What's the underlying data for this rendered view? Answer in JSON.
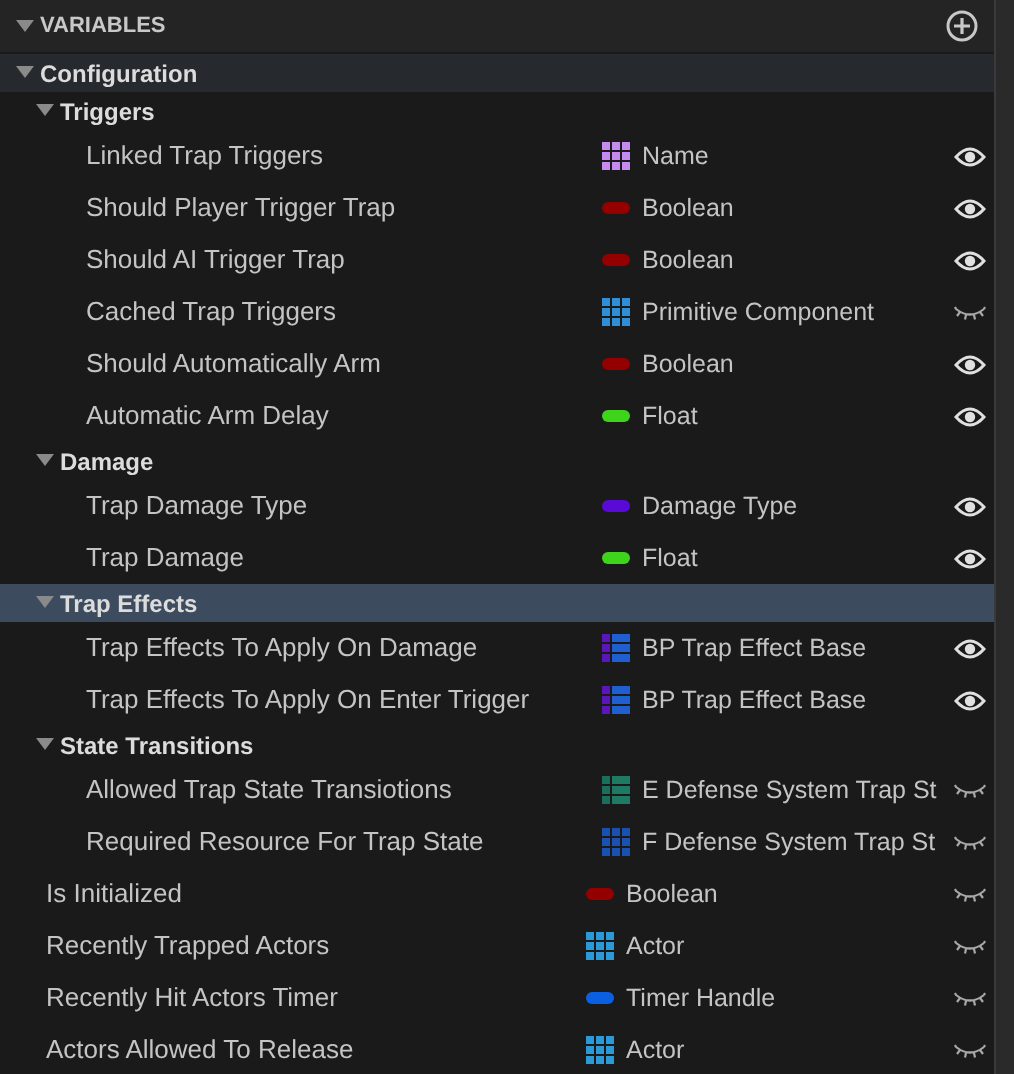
{
  "variables": {
    "title": "VARIABLES",
    "expanded": true,
    "items": [
      {
        "kind": "category",
        "label": "Configuration",
        "expanded": true,
        "selected": false,
        "children": [
          {
            "kind": "category",
            "label": "Triggers",
            "expanded": true,
            "selected": false,
            "children": [
              {
                "kind": "variable",
                "name": "Linked Trap Triggers",
                "type": "Name",
                "pin": {
                  "kind": "array",
                  "color": "#c58af0"
                },
                "visible": true
              },
              {
                "kind": "variable",
                "name": "Should Player Trigger Trap",
                "type": "Boolean",
                "pin": {
                  "kind": "single",
                  "color": "#940000"
                },
                "visible": true
              },
              {
                "kind": "variable",
                "name": "Should AI Trigger Trap",
                "type": "Boolean",
                "pin": {
                  "kind": "single",
                  "color": "#940000"
                },
                "visible": true
              },
              {
                "kind": "variable",
                "name": "Cached Trap Triggers",
                "type": "Primitive Component",
                "pin": {
                  "kind": "array",
                  "color": "#2f8fd6"
                },
                "visible": false
              },
              {
                "kind": "variable",
                "name": "Should Automatically Arm",
                "type": "Boolean",
                "pin": {
                  "kind": "single",
                  "color": "#940000"
                },
                "visible": true
              },
              {
                "kind": "variable",
                "name": "Automatic Arm Delay",
                "type": "Float",
                "pin": {
                  "kind": "single",
                  "color": "#3ed41c"
                },
                "visible": true
              }
            ]
          },
          {
            "kind": "category",
            "label": "Damage",
            "expanded": true,
            "selected": false,
            "children": [
              {
                "kind": "variable",
                "name": "Trap Damage Type",
                "type": "Damage Type",
                "pin": {
                  "kind": "single",
                  "color": "#5a0ad6"
                },
                "visible": true
              },
              {
                "kind": "variable",
                "name": "Trap Damage",
                "type": "Float",
                "pin": {
                  "kind": "single",
                  "color": "#3ed41c"
                },
                "visible": true
              }
            ]
          },
          {
            "kind": "category",
            "label": "Trap Effects",
            "expanded": true,
            "selected": true,
            "children": [
              {
                "kind": "variable",
                "name": "Trap Effects To Apply On Damage",
                "type": "BP Trap Effect Base",
                "pin": {
                  "kind": "map",
                  "color": "#1f5fd0",
                  "key": {
                    "color": "#5a16b8"
                  }
                },
                "visible": true
              },
              {
                "kind": "variable",
                "name": "Trap Effects To Apply On Enter Trigger",
                "type": "BP Trap Effect Base",
                "pin": {
                  "kind": "map",
                  "color": "#1f5fd0",
                  "key": {
                    "color": "#5a16b8"
                  }
                },
                "visible": true
              }
            ]
          },
          {
            "kind": "category",
            "label": "State Transitions",
            "expanded": true,
            "selected": false,
            "children": [
              {
                "kind": "variable",
                "name": "Allowed Trap State Transiotions",
                "type": "E Defense System Trap St",
                "pin": {
                  "kind": "map",
                  "color": "#1f7a64",
                  "key": {
                    "color": "#1a6e5a"
                  }
                },
                "visible": false
              },
              {
                "kind": "variable",
                "name": "Required Resource For Trap State",
                "type": "F Defense System Trap St",
                "pin": {
                  "kind": "array",
                  "color": "#1a50b0"
                },
                "visible": false
              }
            ]
          }
        ]
      },
      {
        "kind": "variable",
        "name": "Is Initialized",
        "type": "Boolean",
        "pin": {
          "kind": "single",
          "color": "#940000"
        },
        "visible": false
      },
      {
        "kind": "variable",
        "name": "Recently Trapped Actors",
        "type": "Actor",
        "pin": {
          "kind": "array",
          "color": "#2b9ad6"
        },
        "visible": false
      },
      {
        "kind": "variable",
        "name": "Recently Hit Actors Timer",
        "type": "Timer Handle",
        "pin": {
          "kind": "single",
          "color": "#0a60e0"
        },
        "visible": false
      },
      {
        "kind": "variable",
        "name": "Actors Allowed To Release",
        "type": "Actor",
        "pin": {
          "kind": "array",
          "color": "#2b9ad6"
        },
        "visible": false
      }
    ]
  }
}
